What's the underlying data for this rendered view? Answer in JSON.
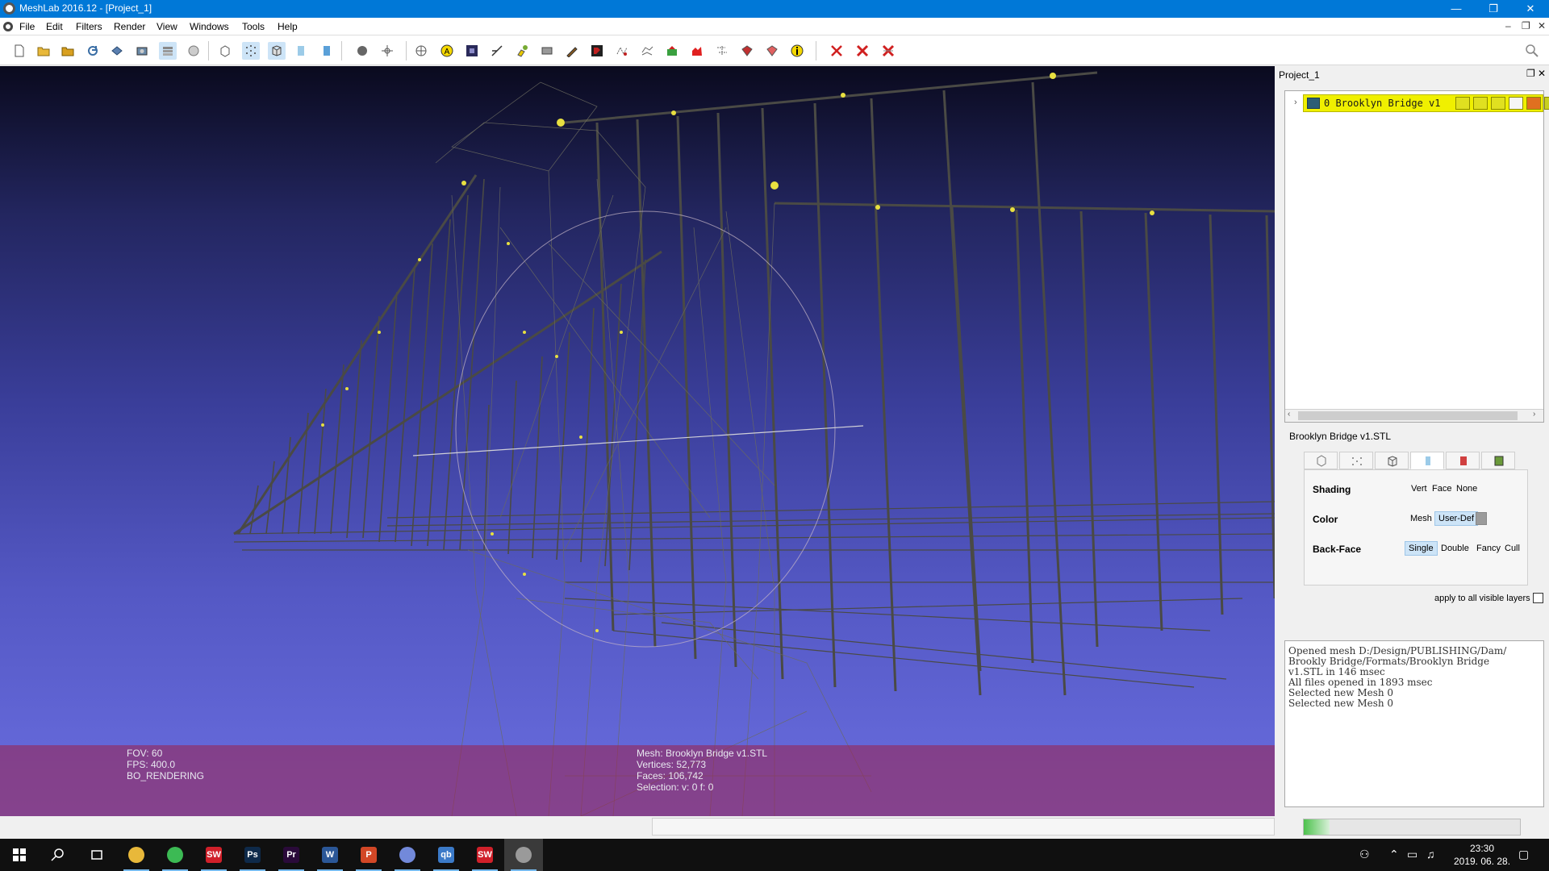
{
  "window": {
    "title": "MeshLab 2016.12 - [Project_1]",
    "minimize": "—",
    "maximize": "❐",
    "close": "✕"
  },
  "menu": {
    "items": [
      "File",
      "Edit",
      "Filters",
      "Render",
      "View",
      "Windows",
      "Tools",
      "Help"
    ],
    "mdi_min": "–",
    "mdi_restore": "❐",
    "mdi_close": "✕"
  },
  "toolbar": {
    "icons": [
      "new-project-icon",
      "open-project-icon",
      "import-mesh-icon",
      "reload-icon",
      "save-snapshot-icon",
      "snapshot-icon",
      "layers-icon",
      "raster-icon",
      "bounding-box-icon",
      "points-icon",
      "wireframe-icon",
      "flat-icon",
      "smooth-icon",
      "light-icon",
      "transform-icon",
      "manipulator-icon",
      "annotate-icon",
      "texture-icon",
      "measure-icon",
      "paint-icon",
      "brush-icon",
      "color-picker-icon",
      "select-vertices-icon",
      "select-faces-icon",
      "select-connected-icon",
      "georef-icon",
      "zoom-region-icon",
      "align-icon",
      "pick-points-icon",
      "info-icon",
      "delete-vertices-icon",
      "delete-faces-icon",
      "delete-all-icon"
    ],
    "search_icon": "search-icon"
  },
  "viewport": {
    "fov_line": "FOV: 60",
    "fps_line": "FPS:   400.0",
    "render_mode": "BO_RENDERING",
    "mesh_line": "Mesh: Brooklyn Bridge v1.STL",
    "vertices_line": "Vertices: 52,773",
    "faces_line": "Faces: 106,742",
    "selection_line": "Selection: v: 0 f: 0"
  },
  "dock": {
    "title": "Project_1",
    "layer": {
      "label": "0 Brooklyn Bridge v1"
    },
    "render": {
      "title": "Brooklyn Bridge v1.STL",
      "shading_label": "Shading",
      "shading_options": [
        "Vert",
        "Face",
        "None"
      ],
      "color_label": "Color",
      "color_options": [
        "Mesh",
        "User-Def"
      ],
      "color_selected": "User-Def",
      "backface_label": "Back-Face",
      "backface_options": [
        "Single",
        "Double",
        "Fancy",
        "Cull"
      ],
      "backface_selected": "Single",
      "apply_all_label": "apply to all visible layers",
      "apply_all_checked": false,
      "swatch_color": "#9b9b9b"
    },
    "log": [
      "Opened mesh D:/Design/PUBLISHING/Dam/",
      "Brookly Bridge/Formats/Brooklyn Bridge",
      "v1.STL in 146 msec",
      "All files opened in 1893 msec",
      "Selected new Mesh 0",
      "Selected new Mesh 0"
    ],
    "progress_fraction": 0.12
  },
  "taskbar": {
    "time": "23:30",
    "date": "2019. 06. 28.",
    "apps": [
      {
        "name": "file-explorer-icon",
        "glyph": "",
        "color": "#e8b83a"
      },
      {
        "name": "chrome-icon",
        "glyph": "",
        "color": "#3cba54"
      },
      {
        "name": "solidworks-icon",
        "glyph": "SW",
        "color": "#d0202a"
      },
      {
        "name": "photoshop-icon",
        "glyph": "Ps",
        "color": "#0e2a4a"
      },
      {
        "name": "premiere-icon",
        "glyph": "Pr",
        "color": "#2a0a3a"
      },
      {
        "name": "word-icon",
        "glyph": "W",
        "color": "#2b5797"
      },
      {
        "name": "powerpoint-icon",
        "glyph": "P",
        "color": "#d24726"
      },
      {
        "name": "discord-icon",
        "glyph": "",
        "color": "#7289da"
      },
      {
        "name": "qbittorrent-icon",
        "glyph": "qb",
        "color": "#3b7ac8"
      },
      {
        "name": "solidworks-icon-2",
        "glyph": "SW",
        "color": "#d0202a"
      },
      {
        "name": "meshlab-icon",
        "glyph": "",
        "color": "#9a9a9a"
      }
    ]
  },
  "colors": {
    "titlebar": "#0078d7",
    "layer_highlight": "#f0f000",
    "overlay": "#96285a",
    "viewport_top": "#0a0a1e",
    "viewport_bottom": "#6a6ee0"
  }
}
